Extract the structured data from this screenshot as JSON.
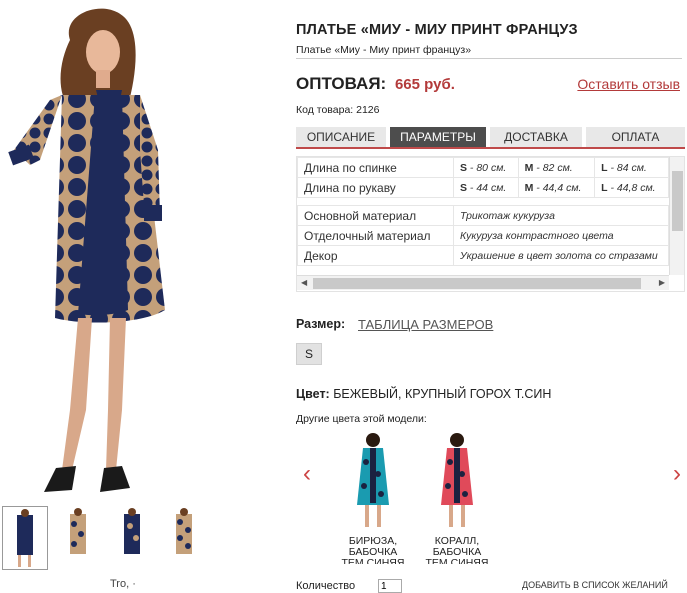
{
  "product": {
    "title": "ПЛАТЬЕ «МИУ - МИУ ПРИНТ ФРАНЦУЗ",
    "subtitle": "Платье «Миу - Миу принт француз»",
    "price_label": "ОПТОВАЯ:",
    "price_value": "665 руб.",
    "review_link": "Оставить отзыв",
    "sku": "Код товара: 2126"
  },
  "tabs": [
    {
      "label": "ОПИСАНИЕ",
      "active": false
    },
    {
      "label": "ПАРАМЕТРЫ",
      "active": true
    },
    {
      "label": "ДОСТАВКА",
      "active": false
    },
    {
      "label": "ОПЛАТА",
      "active": false
    }
  ],
  "params": {
    "rows": [
      {
        "label": "Длина по спинке",
        "s_size": "S",
        "s_val": " - 80 см.",
        "m_size": "M",
        "m_val": " - 82 см.",
        "l_size": "L",
        "l_val": " - 84 см."
      },
      {
        "label": "Длина по рукаву",
        "s_size": "S",
        "s_val": " - 44 см.",
        "m_size": "M",
        "m_val": " - 44,4 см.",
        "l_size": "L",
        "l_val": " - 44,8 см."
      },
      {
        "label": "Основной материал",
        "value": "Трикотаж кукуруза"
      },
      {
        "label": "Отделочный материал",
        "value": "Кукуруза контрастного цвета"
      },
      {
        "label": "Декор",
        "value": "Украшение в цвет золота со стразами"
      }
    ]
  },
  "size": {
    "label": "Размер:",
    "table_link": "ТАБЛИЦА РАЗМЕРОВ",
    "options": [
      "S"
    ]
  },
  "color": {
    "label": "Цвет:",
    "value": "БЕЖЕВЫЙ, КРУПНЫЙ ГОРОХ Т.СИН",
    "other_colors_label": "Другие цвета этой модели:",
    "variants": [
      {
        "caption": "БИРЮЗА, БАБОЧКА ТЕМ.СИНЯЯ",
        "main": "#1a9bb0",
        "dot": "#1b2240"
      },
      {
        "caption": "КОРАЛЛ, БАБОЧКА ТЕМ.СИНЯЯ",
        "main": "#e04a5a",
        "dot": "#1b2240"
      }
    ]
  },
  "footer": {
    "qty_label": "Количество",
    "qty_value": "1",
    "wishlist": "ДОБАВИТЬ В СПИСОК ЖЕЛАНИЙ",
    "cut_text": "Tro, ·"
  },
  "colors": {
    "accent": "#b33a3a",
    "tab_active": "#4d4d4d",
    "dress_navy": "#1e2a5a",
    "dress_beige": "#c4a07a"
  },
  "icons": {
    "prev": "chevron-left",
    "next": "chevron-right"
  }
}
